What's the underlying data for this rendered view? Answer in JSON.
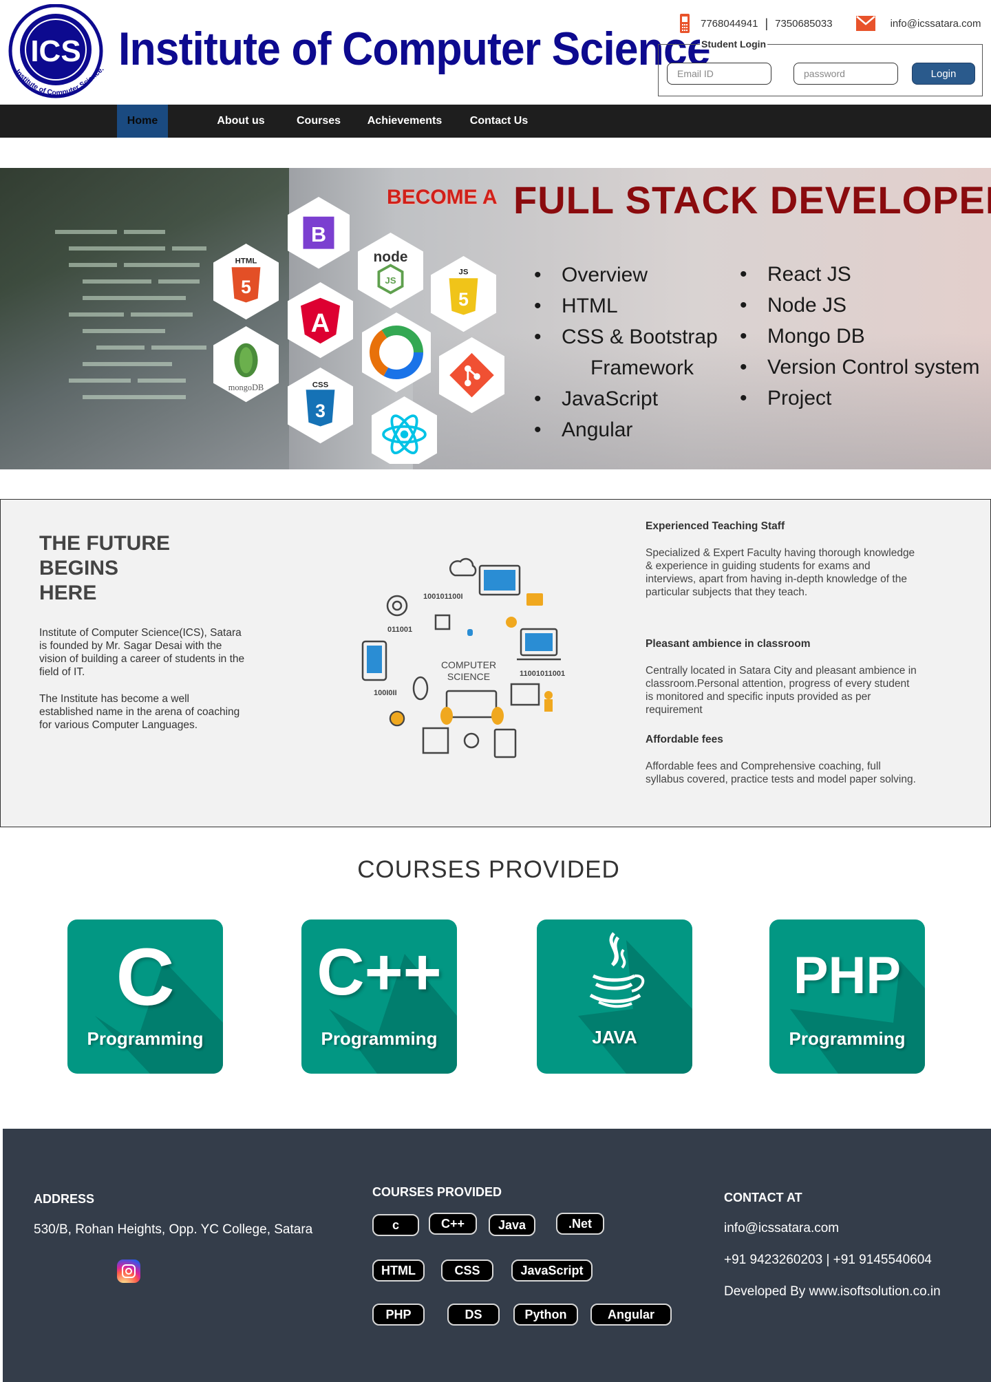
{
  "header": {
    "logo_text": "ICS",
    "logo_ring_text": "Institute of Computer Science.",
    "brand_title": "Institute of Computer Science",
    "phone_1": "7768044941",
    "phone_sep": "|",
    "phone_2": "7350685033",
    "email": "info@icssatara.com",
    "phone_icon": "mobile-phone-icon",
    "mail_icon": "envelope-icon",
    "brand_color": "#0d0a8f"
  },
  "login": {
    "legend": "Student Login",
    "email_placeholder": "Email ID",
    "password_placeholder": "password",
    "button_label": "Login"
  },
  "nav": {
    "items": [
      {
        "label": "Home",
        "active": true
      },
      {
        "label": "About us"
      },
      {
        "label": "Courses"
      },
      {
        "label": "Achievements"
      },
      {
        "label": "Contact Us"
      }
    ]
  },
  "hero": {
    "become": "BECOME A",
    "title": "FULL STACK DEVELOPER",
    "list_left": [
      "Overview",
      "HTML",
      "CSS & Bootstrap",
      "Framework",
      "JavaScript",
      "Angular"
    ],
    "list_right": [
      "React JS",
      "Node JS",
      "Mongo DB",
      "Version Control system",
      "Project"
    ],
    "hex_labels": {
      "html": "HTML",
      "css": "CSS",
      "js": "JS",
      "mongo": "mongoDB",
      "node": "node"
    }
  },
  "about": {
    "heading_lines": [
      "THE FUTURE",
      "BEGINS",
      "HERE"
    ],
    "para_1": "Institute of Computer Science(ICS), Satara is founded by Mr. Sagar Desai with the vision of building a career of students in the field of IT.",
    "para_2": "The Institute has become a well established name in the arena of coaching for various Computer Languages.",
    "graphic_label_1": "COMPUTER",
    "graphic_label_2": "SCIENCE",
    "graphic_bits_1": "100101100I",
    "graphic_bits_2": "011001",
    "graphic_bits_3": "11001011001",
    "graphic_bits_4": "100I0II",
    "features": [
      {
        "title": "Experienced Teaching Staff",
        "text": "Specialized & Expert Faculty having thorough knowledge & experience in guiding students for exams and interviews, apart from having in-depth knowledge of the particular subjects that they teach."
      },
      {
        "title": "Pleasant ambience in classroom",
        "text": "Centrally located in Satara City and pleasant ambience in classroom.Personal attention, progress of every student is monitored and specific inputs provided as per requirement"
      },
      {
        "title": "Affordable fees",
        "text": "Affordable fees and Comprehensive coaching, full syllabus covered, practice tests and model paper solving."
      }
    ]
  },
  "courses": {
    "title": "COURSES PROVIDED",
    "card_color": "#029783",
    "cards": [
      {
        "big": "C",
        "sub": "Programming"
      },
      {
        "big": "C++",
        "sub": "Programming"
      },
      {
        "big": "java-cup-icon",
        "sub": "JAVA"
      },
      {
        "big": "PHP",
        "sub": "Programming"
      }
    ]
  },
  "footer": {
    "address_head": "ADDRESS",
    "address": "530/B, Rohan Heights, Opp. YC College, Satara",
    "courses_head": "COURSES PROVIDED",
    "tags": [
      "c",
      "C++",
      "Java",
      ".Net",
      "HTML",
      "CSS",
      "JavaScript",
      "PHP",
      "DS",
      "Python",
      "Angular"
    ],
    "contact_head": "CONTACT AT",
    "contact_email": "info@icssatara.com",
    "contact_phones": "+91 9423260203 | +91 9145540604",
    "developed_by": "Developed By www.isoftsolution.co.in",
    "social_icon": "instagram-icon",
    "bg_color": "#343d4a"
  }
}
